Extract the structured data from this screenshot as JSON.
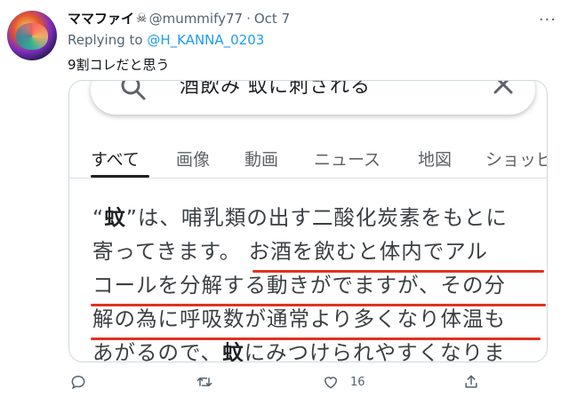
{
  "tweet": {
    "display_name": "ママファイ",
    "handle": "@mummify77",
    "separator": "·",
    "date": "Oct 7",
    "reply_prefix": "Replying to ",
    "reply_handle": "@H_KANNA_0203",
    "text": "9割コレだと思う",
    "like_count": "16"
  },
  "icons": {
    "name_emoji": "skull-and-crossbones-icon",
    "more": "more-icon",
    "reply": "reply-icon",
    "retweet": "retweet-icon",
    "like": "heart-icon",
    "share": "share-icon"
  },
  "screenshot": {
    "search_query": "酒飲み 蚊に刺される",
    "tabs": [
      "すべて",
      "画像",
      "動画",
      "ニュース",
      "地図",
      "ショッピ"
    ],
    "snippet_lines": [
      [
        "“",
        "蚊",
        "”は、哺乳類の出す二酸化炭素をもとに"
      ],
      [
        "寄ってきます。 お酒を飲むと体内でアル"
      ],
      [
        "コールを分解する動きがでますが、その分"
      ],
      [
        "解の為に呼吸数が通常より多くなり体温も"
      ],
      [
        "あがるので、",
        "蚊",
        "にみつけられやすくなりま"
      ]
    ]
  },
  "colors": {
    "link": "#1d9bf0",
    "underline_annotation": "#e0321e"
  }
}
